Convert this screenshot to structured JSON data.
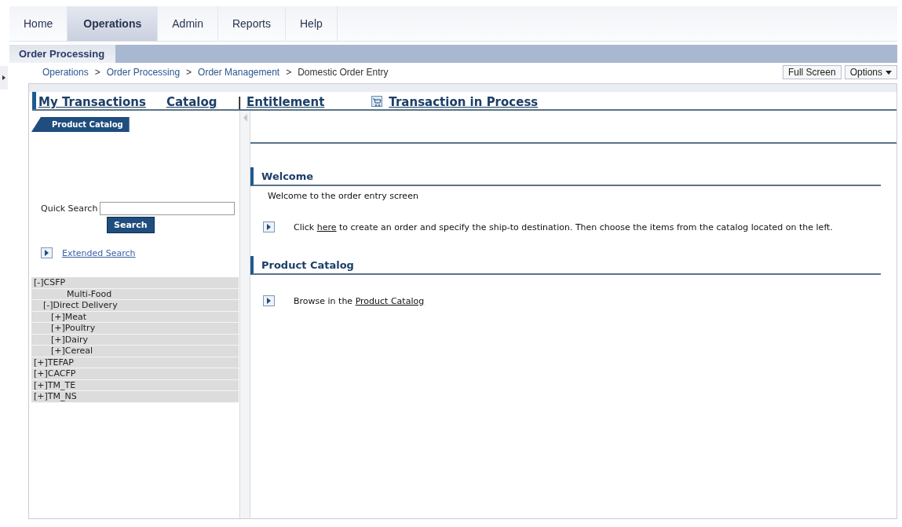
{
  "tabs": [
    {
      "label": "Home",
      "selected": false
    },
    {
      "label": "Operations",
      "selected": true
    },
    {
      "label": "Admin",
      "selected": false
    },
    {
      "label": "Reports",
      "selected": false
    },
    {
      "label": "Help",
      "selected": false
    }
  ],
  "subtabs": [
    {
      "label": "Order Processing",
      "selected": true
    }
  ],
  "breadcrumb": {
    "links": [
      "Operations",
      "Order Processing",
      "Order Management"
    ],
    "separator": ">",
    "current": "Domestic Order Entry"
  },
  "page_buttons": [
    {
      "label": "Full Screen",
      "kind": "plain"
    },
    {
      "label": "Options",
      "kind": "menu"
    }
  ],
  "nav_links": [
    {
      "label": "My Transactions",
      "kind": "link"
    },
    {
      "label": "Catalog",
      "kind": "link"
    },
    {
      "label": "Entitlement",
      "kind": "divided",
      "divider": "|"
    },
    {
      "label": "Transaction in Process",
      "kind": "cart"
    }
  ],
  "sidebar": {
    "header": "Product Catalog",
    "quick_search": {
      "label": "Quick Search",
      "button": "Search"
    },
    "extended_search": "Extended Search",
    "tree": [
      {
        "label": "[-]CSFP",
        "expanded": true,
        "children": [
          {
            "label": "Multi-Food",
            "expanded": false
          },
          {
            "label": "[-]Direct Delivery",
            "expanded": true,
            "children": [
              {
                "label": "[+]Meat",
                "expanded": false
              },
              {
                "label": "[+]Poultry",
                "expanded": false
              },
              {
                "label": "[+]Dairy",
                "expanded": false
              },
              {
                "label": "[+]Cereal",
                "expanded": false
              }
            ]
          }
        ]
      },
      {
        "label": "[+]TEFAP",
        "expanded": false
      },
      {
        "label": "[+]CACFP",
        "expanded": false
      },
      {
        "label": "[+]TM_TE",
        "expanded": false
      },
      {
        "label": "[+]TM_NS",
        "expanded": false
      }
    ]
  },
  "sections": [
    {
      "title": "Welcome",
      "text": "Welcome to the order entry screen",
      "action": {
        "before": "Click",
        "link": "here",
        "after": "to create an order and specify the ship-to destination. Then choose the items from the catalog located on the left."
      }
    },
    {
      "title": "Product Catalog",
      "action": {
        "before": "Browse in the",
        "link": "Product Catalog"
      }
    }
  ]
}
